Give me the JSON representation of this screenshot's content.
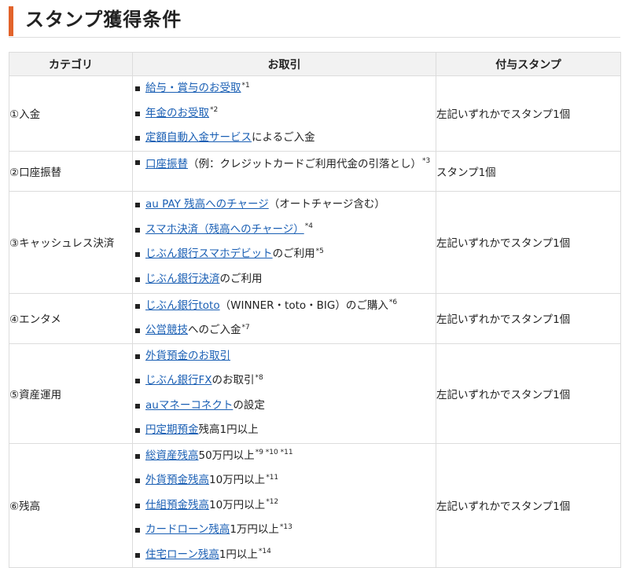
{
  "heading": "スタンプ獲得条件",
  "columns": [
    "カテゴリ",
    "お取引",
    "付与スタンプ"
  ],
  "rows": [
    {
      "category": "①入金",
      "stamp": "左記いずれかでスタンプ1個",
      "items": [
        {
          "link": "給与・賞与のお受取",
          "suffix": "",
          "note": "*1"
        },
        {
          "link": "年金のお受取",
          "suffix": "",
          "note": "*2"
        },
        {
          "link": "定額自動入金サービス",
          "suffix": "によるご入金",
          "note": ""
        }
      ]
    },
    {
      "category": "②口座振替",
      "stamp": "スタンプ1個",
      "items": [
        {
          "link": "口座振替",
          "suffix": "（例：クレジットカードご利用代金の引落とし）",
          "note": "*3",
          "two_line": true
        }
      ]
    },
    {
      "category": "③キャッシュレス決済",
      "stamp": "左記いずれかでスタンプ1個",
      "items": [
        {
          "link": "au PAY 残高へのチャージ",
          "suffix": "（オートチャージ含む）",
          "note": ""
        },
        {
          "link": "スマホ決済（残高へのチャージ）",
          "suffix": "",
          "note": "*4"
        },
        {
          "link": "じぶん銀行スマホデビット",
          "suffix": "のご利用",
          "note": "*5"
        },
        {
          "link": "じぶん銀行決済",
          "suffix": "のご利用",
          "note": ""
        }
      ]
    },
    {
      "category": "④エンタメ",
      "stamp": "左記いずれかでスタンプ1個",
      "items": [
        {
          "link": "じぶん銀行toto",
          "suffix": "（WINNER・toto・BIG）のご購入",
          "note": "*6"
        },
        {
          "link": "公営競技",
          "suffix": "へのご入金",
          "note": "*7"
        }
      ]
    },
    {
      "category": "⑤資産運用",
      "stamp": "左記いずれかでスタンプ1個",
      "items": [
        {
          "link": "外貨預金のお取引",
          "suffix": "",
          "note": ""
        },
        {
          "link": "じぶん銀行FX",
          "suffix": "のお取引",
          "note": "*8"
        },
        {
          "link": "auマネーコネクト",
          "suffix": "の設定",
          "note": ""
        },
        {
          "link": "円定期預金",
          "suffix": "残高1円以上",
          "note": ""
        }
      ]
    },
    {
      "category": "⑥残高",
      "stamp": "左記いずれかでスタンプ1個",
      "items": [
        {
          "link": "総資産残高",
          "suffix": "50万円以上",
          "note": "*9 *10 *11"
        },
        {
          "link": "外貨預金残高",
          "suffix": "10万円以上",
          "note": "*11"
        },
        {
          "link": "仕組預金残高",
          "suffix": "10万円以上",
          "note": "*12"
        },
        {
          "link": "カードローン残高",
          "suffix": "1万円以上",
          "note": "*13"
        },
        {
          "link": "住宅ローン残高",
          "suffix": "1円以上",
          "note": "*14"
        }
      ]
    }
  ],
  "colors": {
    "accent": "#e2632b",
    "link": "#1a5fb4",
    "header_bg": "#f2f2f2",
    "border": "#dcdcdc"
  }
}
